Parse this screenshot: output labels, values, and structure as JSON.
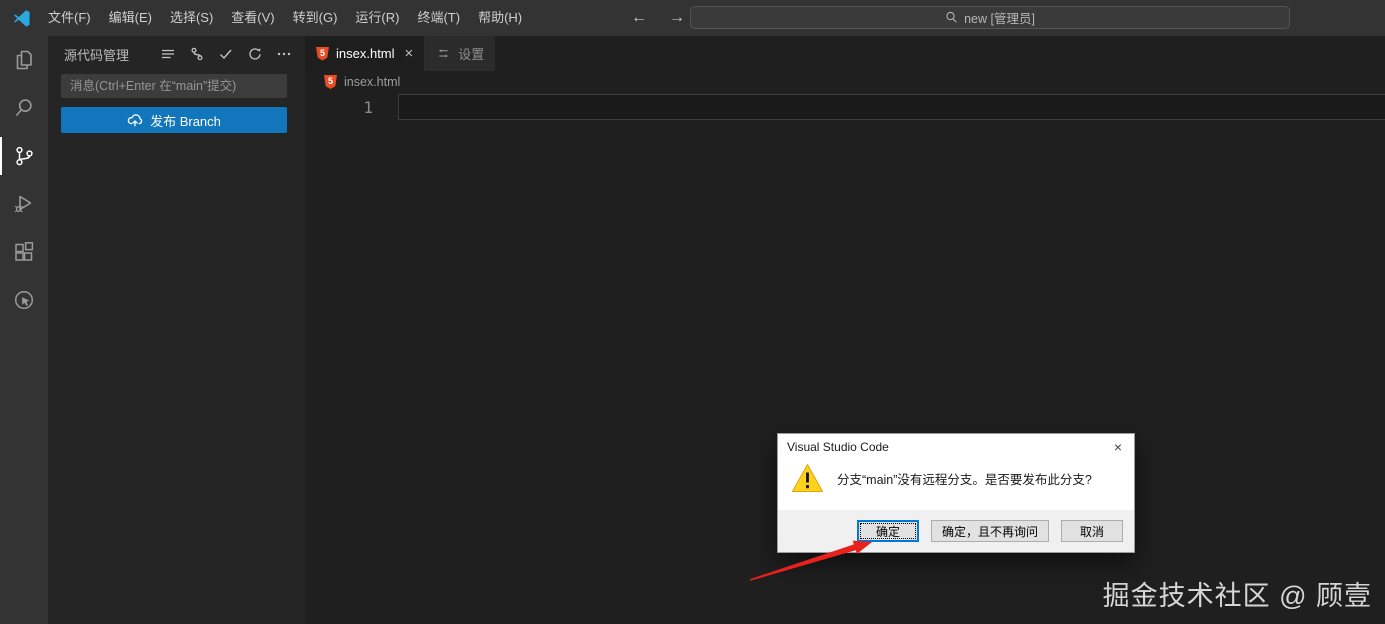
{
  "titlebar": {
    "menus": [
      "文件(F)",
      "编辑(E)",
      "选择(S)",
      "查看(V)",
      "转到(G)",
      "运行(R)",
      "终端(T)",
      "帮助(H)"
    ],
    "back_arrow": "←",
    "forward_arrow": "→",
    "search_text": "new [管理员]"
  },
  "activity_bar": {
    "items": [
      "explorer",
      "search",
      "source-control",
      "run-and-debug",
      "extensions",
      "live-preview"
    ]
  },
  "scm": {
    "title": "源代码管理",
    "message_placeholder": "消息(Ctrl+Enter 在“main”提交)",
    "publish_button": "发布 Branch"
  },
  "editor": {
    "tabs": [
      {
        "label": "insex.html",
        "active": true
      },
      {
        "label": "设置",
        "active": false
      }
    ],
    "tab_close": "×",
    "file_icon_label": "5",
    "breadcrumb": "insex.html",
    "line_number": "1"
  },
  "dialog": {
    "title": "Visual Studio Code",
    "close": "×",
    "message": "分支“main”没有远程分支。是否要发布此分支?",
    "buttons": [
      "确定",
      "确定，且不再询问",
      "取消"
    ]
  },
  "watermark": "掘金技术社区 @ 顾壹",
  "colors": {
    "accent_blue": "#1176bb",
    "titlebar": "#333333",
    "sidebar": "#252526",
    "editor": "#1f1f1f",
    "dialog_footer": "#f0f0f0",
    "focus_border": "#0078d7",
    "warning_yellow": "#ffd21e",
    "arrow_red": "#e8211a",
    "html_icon_orange": "#e44d26"
  }
}
